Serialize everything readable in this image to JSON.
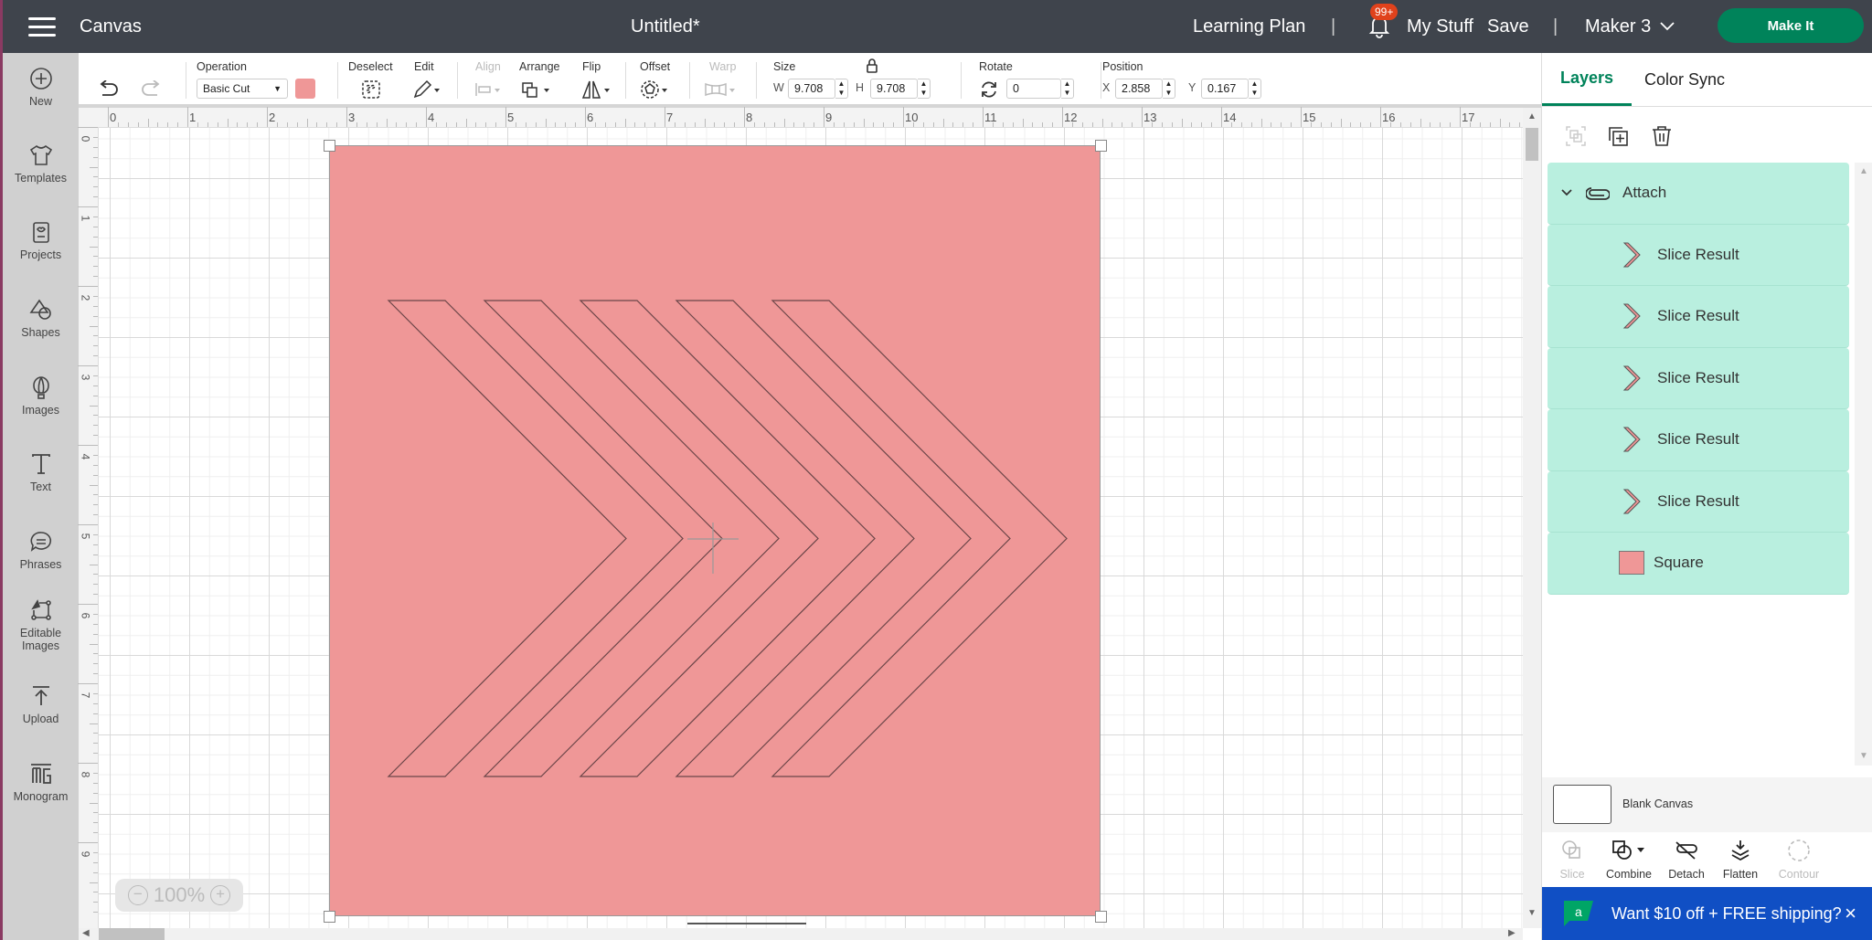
{
  "topbar": {
    "menu_icon": "hamburger-icon",
    "section": "Canvas",
    "doc_title": "Untitled*",
    "learning_plan": "Learning Plan",
    "separator": "|",
    "notifications_badge": "99+",
    "my_stuff": "My Stuff",
    "save": "Save",
    "machine": "Maker 3",
    "make_it": "Make It"
  },
  "toolbar": {
    "operation_label": "Operation",
    "operation_value": "Basic Cut",
    "operation_color": "#ef9797",
    "deselect": "Deselect",
    "edit": "Edit",
    "align": "Align",
    "arrange": "Arrange",
    "flip": "Flip",
    "offset": "Offset",
    "warp": "Warp",
    "size_label": "Size",
    "w_label": "W",
    "w_value": "9.708",
    "h_label": "H",
    "h_value": "9.708",
    "rotate_label": "Rotate",
    "rotate_value": "0",
    "position_label": "Position",
    "x_label": "X",
    "x_value": "2.858",
    "y_label": "Y",
    "y_value": "0.167"
  },
  "leftnav": {
    "items": [
      {
        "label": "New",
        "icon": "plus-circle-icon"
      },
      {
        "label": "Templates",
        "icon": "tshirt-icon"
      },
      {
        "label": "Projects",
        "icon": "project-card-icon"
      },
      {
        "label": "Shapes",
        "icon": "shapes-icon"
      },
      {
        "label": "Images",
        "icon": "balloon-icon"
      },
      {
        "label": "Text",
        "icon": "text-icon"
      },
      {
        "label": "Phrases",
        "icon": "speech-bubble-icon"
      },
      {
        "label": "Editable Images",
        "icon": "editable-images-icon"
      },
      {
        "label": "Upload",
        "icon": "upload-icon"
      },
      {
        "label": "Monogram",
        "icon": "monogram-icon"
      }
    ]
  },
  "rulers": {
    "top": [
      "0",
      "1",
      "2",
      "3",
      "4",
      "5",
      "6",
      "7",
      "8",
      "9",
      "10",
      "11",
      "12",
      "13",
      "14",
      "15",
      "16",
      "17"
    ],
    "left": [
      "0",
      "1",
      "2",
      "3",
      "4",
      "5",
      "6",
      "7",
      "8",
      "9"
    ]
  },
  "canvas": {
    "zoom": "100%",
    "design_color": "#ef9797",
    "chevron_count": 5
  },
  "rightpanel": {
    "tabs": [
      {
        "label": "Layers",
        "active": true
      },
      {
        "label": "Color Sync",
        "active": false
      }
    ],
    "layers": [
      {
        "name": "Attach",
        "type": "group"
      },
      {
        "name": "Slice Result",
        "type": "slice"
      },
      {
        "name": "Slice Result",
        "type": "slice"
      },
      {
        "name": "Slice Result",
        "type": "slice"
      },
      {
        "name": "Slice Result",
        "type": "slice"
      },
      {
        "name": "Slice Result",
        "type": "slice"
      },
      {
        "name": "Square",
        "type": "shape",
        "color": "#ef9797"
      }
    ],
    "blank_canvas": "Blank Canvas",
    "actions": [
      {
        "label": "Slice",
        "enabled": false
      },
      {
        "label": "Combine",
        "enabled": true
      },
      {
        "label": "Detach",
        "enabled": true
      },
      {
        "label": "Flatten",
        "enabled": true
      },
      {
        "label": "Contour",
        "enabled": false
      }
    ],
    "promo": "Want $10 off + FREE shipping?",
    "promo_close": "×"
  },
  "colors": {
    "accent": "#00835a",
    "topbar": "#3f444c",
    "layer_bg": "#b9efdf",
    "promo_bg": "#104fc4"
  }
}
